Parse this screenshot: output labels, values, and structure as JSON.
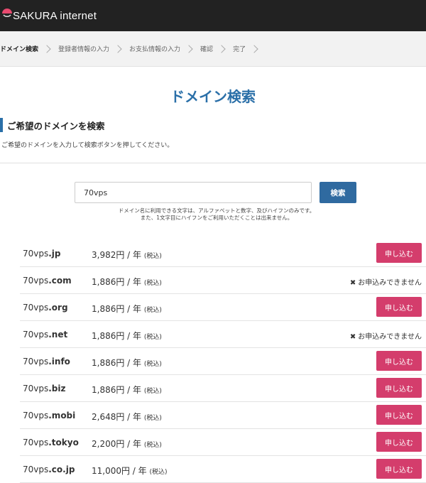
{
  "header": {
    "brand": "SAKURA internet"
  },
  "steps": [
    {
      "label": "ドメイン検索",
      "active": true
    },
    {
      "label": "登録者情報の入力",
      "active": false
    },
    {
      "label": "お支払情報の入力",
      "active": false
    },
    {
      "label": "確認",
      "active": false
    },
    {
      "label": "完了",
      "active": false
    }
  ],
  "page": {
    "title": "ドメイン検索",
    "section_title": "ご希望のドメインを検索",
    "section_desc": "ご希望のドメインを入力して検索ボタンを押してください。"
  },
  "search": {
    "value": "70vps",
    "button_label": "検索",
    "note_line1": "ドメイン名に利用できる文字は、アルファベットと数字、及びハイフンのみです。",
    "note_line2": "また、1文字目にハイフンをご利用いただくことは出来ません。"
  },
  "labels": {
    "apply": "申し込む",
    "unavailable": "お申込みできません",
    "unavailable_icon": "✖",
    "tax": "(税込)"
  },
  "results": [
    {
      "name": "70vps",
      "tld": ".jp",
      "price": "3,982円 / 年",
      "available": true
    },
    {
      "name": "70vps",
      "tld": ".com",
      "price": "1,886円 / 年",
      "available": false
    },
    {
      "name": "70vps",
      "tld": ".org",
      "price": "1,886円 / 年",
      "available": true
    },
    {
      "name": "70vps",
      "tld": ".net",
      "price": "1,886円 / 年",
      "available": false
    },
    {
      "name": "70vps",
      "tld": ".info",
      "price": "1,886円 / 年",
      "available": true
    },
    {
      "name": "70vps",
      "tld": ".biz",
      "price": "1,886円 / 年",
      "available": true
    },
    {
      "name": "70vps",
      "tld": ".mobi",
      "price": "2,648円 / 年",
      "available": true
    },
    {
      "name": "70vps",
      "tld": ".tokyo",
      "price": "2,200円 / 年",
      "available": true
    },
    {
      "name": "70vps",
      "tld": ".co.jp",
      "price": "11,000円 / 年",
      "available": true
    }
  ],
  "colors": {
    "accent": "#2a6fa8",
    "apply": "#d43d6c",
    "topbar": "#222222"
  }
}
